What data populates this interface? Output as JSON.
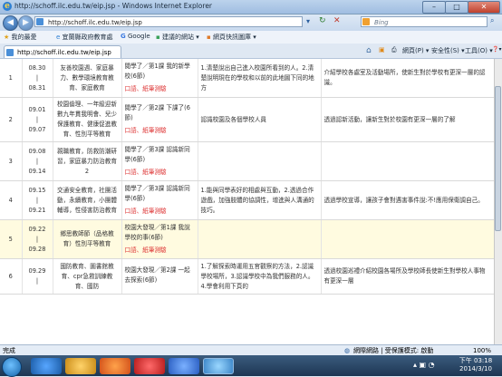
{
  "window": {
    "title": "http://schoff.ilc.edu.tw/eip.jsp - Windows Internet Explorer",
    "min": "–",
    "max": "□",
    "close": "✕"
  },
  "address": {
    "url": "http://schoff.ilc.edu.tw/eip.jsp",
    "search_placeholder": "Bing"
  },
  "favorites": {
    "label": "我的最愛",
    "items": [
      "宜蘭縣政府教育處",
      "Google",
      "建議的網站 ▾",
      "網頁快訊圖庫 ▾"
    ]
  },
  "tab": {
    "title": "http://schoff.ilc.edu.tw/eip.jsp"
  },
  "commands": [
    "網頁(P) ▾",
    "安全性(S) ▾",
    "工具(O) ▾",
    "❓▾"
  ],
  "rows": [
    {
      "num": "1",
      "date_from": "08.30",
      "sep": "|",
      "date_to": "08.31",
      "target": "友善校園週、家庭暴力、數學環境教育教育、家庭教育",
      "unit": "閱學了／第1課 我的新學校(6節)",
      "eval": "口語、紙筆測驗",
      "goal": "1.清楚說出自己進入校園所看到的人。2.清楚說明現在的學校和以前的此地圖下同的地方",
      "note": "介紹學校各處室及活動場所，使新生對於學校有更深一層的認識。",
      "highlight": false
    },
    {
      "num": "2",
      "date_from": "09.01",
      "sep": "|",
      "date_to": "09.07",
      "target": "校園倫理、一年級迎新數九年貫我明會、兒少保護教育、健康促進教育、性別平等教育",
      "unit": "閱學了／第2課 下課了(6節)",
      "eval": "口語、紙筆測驗",
      "goal": "認識校園及各個學校人員",
      "note": "透過認新活動，讓新生對於校園有更深一層的了解",
      "highlight": false
    },
    {
      "num": "3",
      "date_from": "09.08",
      "sep": "|",
      "date_to": "09.14",
      "target": "親職教育，防救防潮研習，家庭暴力防治教育2",
      "unit": "閱學了／第3課 認識新同學(6節)",
      "eval": "口語、紙筆測驗",
      "goal": "",
      "note": "",
      "highlight": false
    },
    {
      "num": "4",
      "date_from": "09.15",
      "sep": "|",
      "date_to": "09.21",
      "target": "交通安全教育，社團活動，永續教育，小團體輔導，性侵害防治教育",
      "unit": "閱學了／第3課 認識新同學(6節)",
      "eval": "口語、紙筆測驗",
      "goal": "1.能與同學表好的相處與互動，2.透過合作遊戲，加強肢體的協調性，增進與人溝通的技巧。",
      "note": "透過學校宣導，讓孩子會對遇害事件說:不!應用保衛調自己。",
      "highlight": false
    },
    {
      "num": "5",
      "date_from": "09.22",
      "sep": "|",
      "date_to": "09.28",
      "target": "鄉思教師節（品格教育）性別平等教育",
      "unit": "校園大發現／第1課 我說學校的事(6節)",
      "eval": "口語、紙筆測驗",
      "goal": "",
      "note": "",
      "highlight": true
    },
    {
      "num": "6",
      "date_from": "09.29",
      "sep": "|",
      "date_to": "",
      "target": "國防教育、圖書館教育、cpr急救訓練教育、國防",
      "unit": "校園大發現／第2課 一起去探索(6節)",
      "eval": "",
      "goal": "1.了解探索時運用五官觀察的方法，2.認識學校場所，3.認識學校中為我們服務的人。4.學會利用下頁的",
      "note": "透過校園巡禮介紹校園各場所及學校師長使新生對學校人事物有更深一層",
      "highlight": false
    }
  ],
  "status": {
    "left": "完成",
    "zone": "網際網路 | 受保護模式: 啟動",
    "zoom": "100%"
  },
  "clock": {
    "time": "下午 03:18",
    "date": "2014/3/10"
  },
  "colors": {
    "accent": "#2d7fd3",
    "eval_red": "#dd3333",
    "highlight_row": "#fffbe0"
  }
}
